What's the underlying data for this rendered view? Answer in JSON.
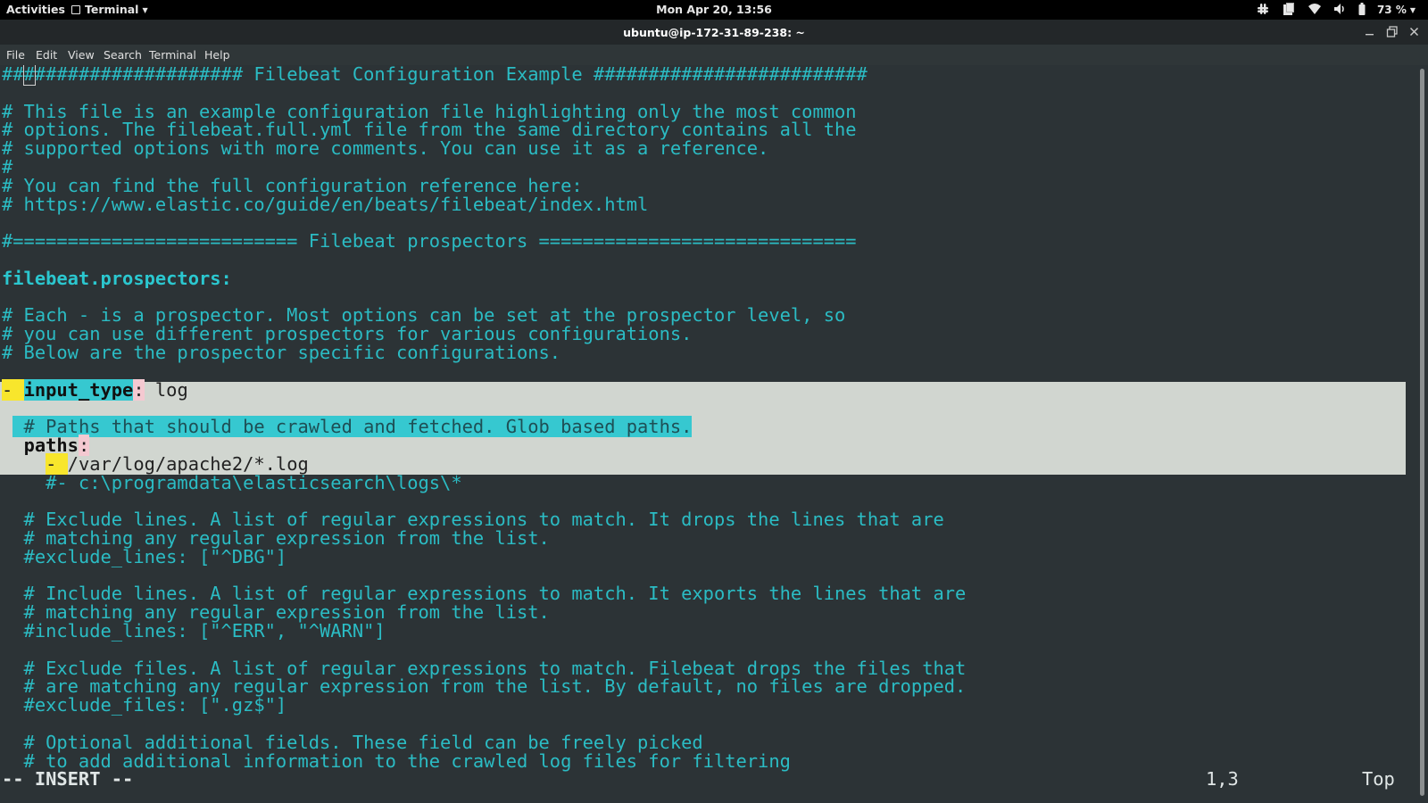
{
  "topbar": {
    "activities": "Activities",
    "app_menu": "Terminal",
    "clock": "Mon Apr 20, 13:56",
    "battery": "73 %",
    "icons": [
      "slack-icon",
      "clipboard-icon",
      "wifi-icon",
      "volume-icon",
      "battery-icon"
    ]
  },
  "window": {
    "title": "ubuntu@ip-172-31-89-238: ~"
  },
  "menu": {
    "file": "File",
    "edit": "Edit",
    "view": "View",
    "search": "Search",
    "terminal": "Terminal",
    "help": "Help"
  },
  "editor": {
    "l1_pre": "##",
    "l1_cursor": "#",
    "l1_post": "################### Filebeat Configuration Example #########################",
    "l3": "# This file is an example configuration file highlighting only the most common",
    "l4": "# options. The filebeat.full.yml file from the same directory contains all the",
    "l5": "# supported options with more comments. You can use it as a reference.",
    "l6": "#",
    "l7": "# You can find the full configuration reference here:",
    "l8": "# https://www.elastic.co/guide/en/beats/filebeat/index.html",
    "l10": "#========================== Filebeat prospectors =============================",
    "l12_key": "filebeat.prospectors",
    "l12_colon": ":",
    "l14": "# Each - is a prospector. Most options can be set at the prospector level, so",
    "l15": "# you can use different prospectors for various configurations.",
    "l16": "# Below are the prospector specific configurations.",
    "l18_dash": "-",
    "l18_sp": " ",
    "l18_key": "input_type",
    "l18_colon": ":",
    "l18_val": " log",
    "l20_indent": " ",
    "l20_comment": " # Paths that should be crawled and fetched. Glob based paths.",
    "l21_indent": "  ",
    "l21_key": "paths",
    "l21_colon": ":",
    "l22_indent": "    ",
    "l22_dash": "- ",
    "l22_val": "/var/log/apache2/*.log",
    "l23": "    #- c:\\programdata\\elasticsearch\\logs\\*",
    "l25": "  # Exclude lines. A list of regular expressions to match. It drops the lines that are",
    "l26": "  # matching any regular expression from the list.",
    "l27": "  #exclude_lines: [\"^DBG\"]",
    "l29": "  # Include lines. A list of regular expressions to match. It exports the lines that are",
    "l30": "  # matching any regular expression from the list.",
    "l31": "  #include_lines: [\"^ERR\", \"^WARN\"]",
    "l33": "  # Exclude files. A list of regular expressions to match. Filebeat drops the files that",
    "l34": "  # are matching any regular expression from the list. By default, no files are dropped.",
    "l35": "  #exclude_files: [\".gz$\"]",
    "l37": "  # Optional additional fields. These field can be freely picked",
    "l38": "  # to add additional information to the crawled log files for filtering"
  },
  "status": {
    "mode": "-- INSERT --",
    "position": "1,3",
    "scroll": "Top"
  },
  "colors": {
    "background": "#2c3336",
    "text": "#2bbcc4",
    "highlight_band": "#d1d6d0",
    "keyword_bg": "#36c8d0",
    "dash_bg": "#f8e62c",
    "colon_bg": "#f4c9d1"
  }
}
